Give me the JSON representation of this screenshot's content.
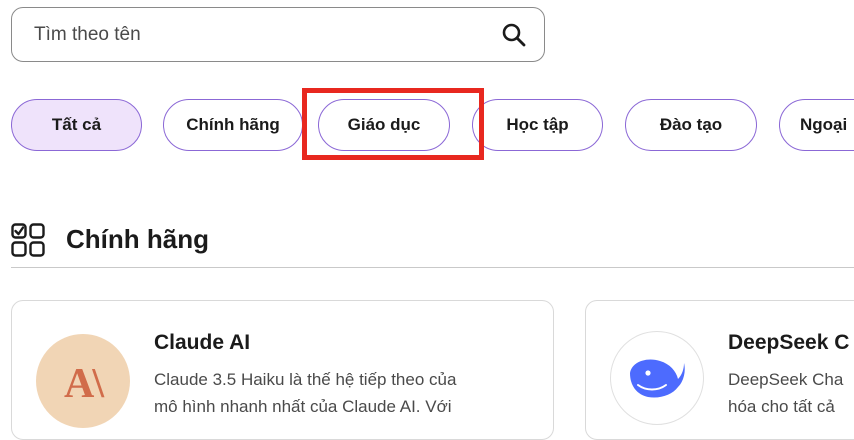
{
  "search": {
    "placeholder": "Tìm theo tên",
    "icon": "search-icon"
  },
  "filters": [
    {
      "label": "Tất cả",
      "active": true
    },
    {
      "label": "Chính hãng"
    },
    {
      "label": "Giáo dục",
      "highlighted": true
    },
    {
      "label": "Học tập"
    },
    {
      "label": "Đào tạo"
    },
    {
      "label": "Ngoại"
    }
  ],
  "section": {
    "title": "Chính hãng",
    "icon": "grid-check-icon"
  },
  "cards": [
    {
      "title": "Claude AI",
      "logo_text": "A\\",
      "desc_line1": "Claude 3.5 Haiku là thế hệ tiếp theo của",
      "desc_line2": "mô hình nhanh nhất của Claude AI. Với"
    },
    {
      "title": "DeepSeek C",
      "logo": "whale-icon",
      "desc_line1": "DeepSeek Cha",
      "desc_line2": "hóa cho tất cả"
    }
  ],
  "colors": {
    "accent_border": "#8b68d6",
    "active_chip_bg": "#efe3fb",
    "highlight_box": "#e8281f",
    "claude_logo_bg": "#f1d5b5",
    "claude_logo_fg": "#d16c4a",
    "deepseek_blue": "#4d6bfe"
  }
}
